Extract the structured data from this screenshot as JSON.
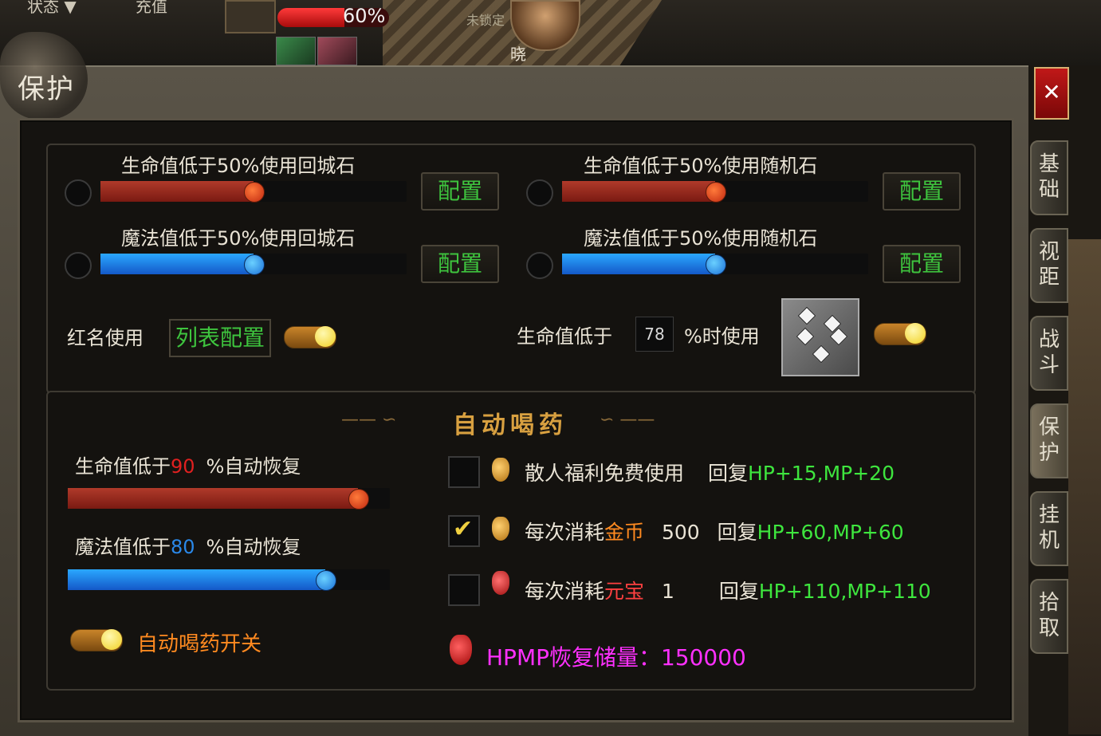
{
  "hud": {
    "tab_status": "状态 ▼",
    "tab_recharge": "充值",
    "hp_percent_text": "60%",
    "hp_fraction": 0.6,
    "lock_label": "未锁定",
    "player_name": "晓"
  },
  "panel": {
    "title": "保护",
    "close_label": "✕"
  },
  "protect": {
    "rows": [
      {
        "label": "生命值低于50%使用回城石",
        "config": "配置",
        "level": 0.5,
        "kind": "hp"
      },
      {
        "label": "生命值低于50%使用随机石",
        "config": "配置",
        "level": 0.5,
        "kind": "hp"
      },
      {
        "label": "魔法值低于50%使用回城石",
        "config": "配置",
        "level": 0.5,
        "kind": "mp"
      },
      {
        "label": "魔法值低于50%使用随机石",
        "config": "配置",
        "level": 0.5,
        "kind": "mp"
      }
    ],
    "red_name_label": "红名使用",
    "list_config": "列表配置",
    "hp_below_label": "生命值低于",
    "hp_below_value": "78",
    "percent_use_label": "%时使用"
  },
  "auto_potion": {
    "title": "自动喝药",
    "hp_prefix": "生命值低于",
    "hp_value": "90",
    "hp_suffix": "%自动恢复",
    "hp_level": 0.9,
    "mp_prefix": "魔法值低于",
    "mp_value": "80",
    "mp_suffix": "%自动恢复",
    "mp_level": 0.8,
    "switch_label": "自动喝药开关",
    "options": [
      {
        "checked": false,
        "text_a": "散人福利免费使用",
        "text_b": "",
        "amount": "",
        "restore": "回复",
        "effect": "HP+15,MP+20"
      },
      {
        "checked": true,
        "text_a": "每次消耗",
        "text_b": "金币",
        "amount": "500",
        "restore": "回复",
        "effect": "HP+60,MP+60"
      },
      {
        "checked": false,
        "text_a": "每次消耗",
        "text_b": "元宝",
        "amount": "1",
        "restore": "回复",
        "effect": "HP+110,MP+110"
      }
    ],
    "storage_label": "HPMP恢复储量：150000"
  },
  "side_tabs": [
    "基础",
    "视距",
    "战斗",
    "保护",
    "挂机",
    "拾取"
  ],
  "colors": {
    "green": "#3ee63e",
    "red_value": "#e02020",
    "blue_value": "#2a88e8",
    "orange": "#ff8a20",
    "magenta": "#ff30ff"
  }
}
